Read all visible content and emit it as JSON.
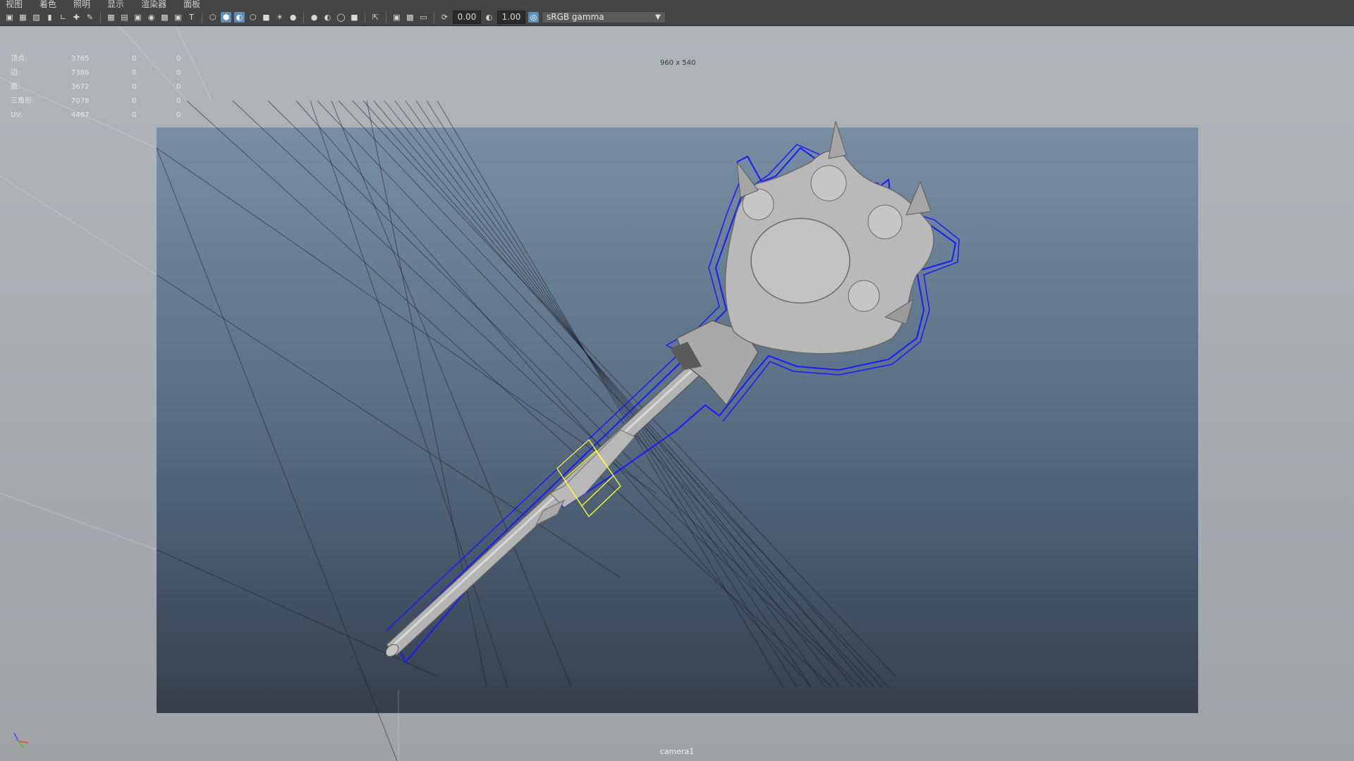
{
  "menu": {
    "items": [
      "视图",
      "着色",
      "照明",
      "显示",
      "渲染器",
      "面板"
    ]
  },
  "toolbar": {
    "exposure_value": "0.00",
    "gamma_value": "1.00",
    "color_space": "sRGB gamma",
    "icons": [
      "camera-select-icon",
      "camera-attributes-icon",
      "bookmark-icon",
      "image-plane-icon",
      "grid-icon",
      "film-gate-icon",
      "resolution-gate-icon",
      "gate-mask-icon",
      "field-chart-icon",
      "safe-action-icon",
      "safe-title-icon",
      "wireframe-icon",
      "smooth-shade-icon",
      "wireframe-on-shaded-icon",
      "textured-icon",
      "lights-icon",
      "shadows-icon",
      "ambient-occlusion-icon",
      "motion-blur-icon",
      "anti-alias-icon",
      "isolate-select-icon",
      "xray-icon",
      "xray-joints-icon",
      "backface-icon",
      "exposure-icon",
      "gamma-icon",
      "color-management-icon"
    ]
  },
  "hud": {
    "rows": [
      {
        "label": "顶点:",
        "v1": "3765",
        "v2": "0",
        "v3": "0"
      },
      {
        "label": "边:",
        "v1": "7386",
        "v2": "0",
        "v3": "0"
      },
      {
        "label": "面:",
        "v1": "3672",
        "v2": "0",
        "v3": "0"
      },
      {
        "label": "三角形:",
        "v1": "7078",
        "v2": "0",
        "v3": "0"
      },
      {
        "label": "UV:",
        "v1": "4467",
        "v2": "0",
        "v3": "0"
      }
    ]
  },
  "viewport": {
    "resolution_label": "960 x 540",
    "camera_label": "camera1",
    "selection_color": "#1a1aff",
    "manipulator_color": "#ffff33"
  }
}
